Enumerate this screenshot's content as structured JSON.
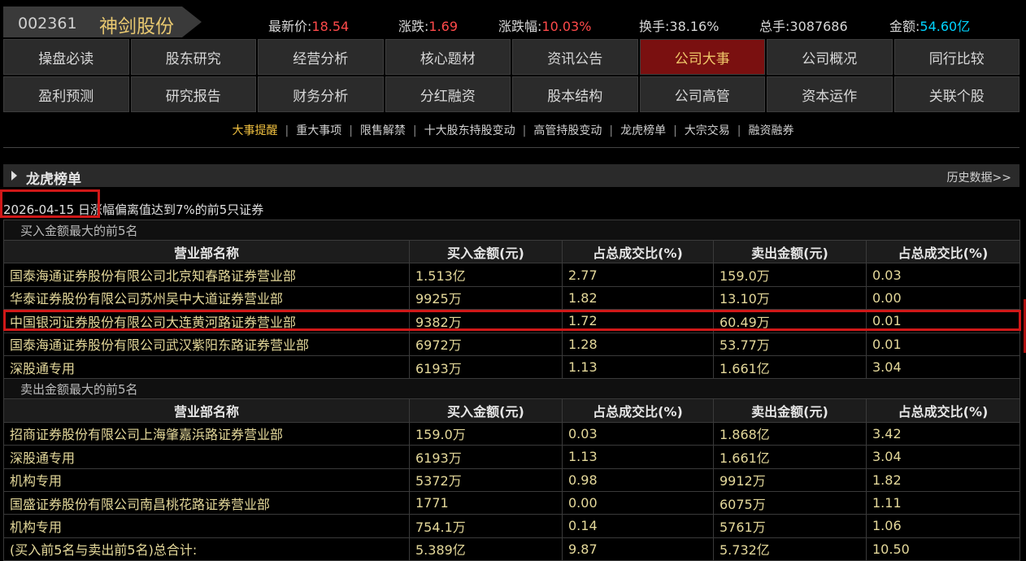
{
  "quote": {
    "code": "002361",
    "name": "神剑股份",
    "price_label": "最新价:",
    "price": "18.54",
    "change_label": "涨跌:",
    "change": "1.69",
    "pct_label": "涨跌幅:",
    "pct": "10.03%",
    "turnover_label": "换手:",
    "turnover": "38.16%",
    "volume_label": "总手:",
    "volume": "3087686",
    "amount_label": "金额:",
    "amount": "54.60亿"
  },
  "nav": [
    "操盘必读",
    "股东研究",
    "经营分析",
    "核心题材",
    "资讯公告",
    "公司大事",
    "公司概况",
    "同行比较",
    "盈利预测",
    "研究报告",
    "财务分析",
    "分红融资",
    "股本结构",
    "公司高管",
    "资本运作",
    "关联个股"
  ],
  "subnav": [
    "大事提醒",
    "重大事项",
    "限售解禁",
    "十大股东持股变动",
    "高管持股变动",
    "龙虎榜单",
    "大宗交易",
    "融资融券"
  ],
  "section": {
    "title": "龙虎榜单",
    "history": "历史数据>>",
    "date": "2026-04-15",
    "date_desc": "日涨幅偏离值达到7%的前5只证券"
  },
  "table": {
    "buy_group": "买入金额最大的前5名",
    "sell_group": "卖出金额最大的前5名",
    "headers": [
      "营业部名称",
      "买入金额(元)",
      "占总成交比(%)",
      "卖出金额(元)",
      "占总成交比(%)"
    ],
    "buy_rows": [
      [
        "国泰海通证券股份有限公司北京知春路证券营业部",
        "1.513亿",
        "2.77",
        "159.0万",
        "0.03"
      ],
      [
        "华泰证券股份有限公司苏州吴中大道证券营业部",
        "9925万",
        "1.82",
        "13.10万",
        "0.00"
      ],
      [
        "中国银河证券股份有限公司大连黄河路证券营业部",
        "9382万",
        "1.72",
        "60.49万",
        "0.01"
      ],
      [
        "国泰海通证券股份有限公司武汉紫阳东路证券营业部",
        "6972万",
        "1.28",
        "53.77万",
        "0.01"
      ],
      [
        "深股通专用",
        "6193万",
        "1.13",
        "1.661亿",
        "3.04"
      ]
    ],
    "sell_rows": [
      [
        "招商证券股份有限公司上海肇嘉浜路证券营业部",
        "159.0万",
        "0.03",
        "1.868亿",
        "3.42"
      ],
      [
        "深股通专用",
        "6193万",
        "1.13",
        "1.661亿",
        "3.04"
      ],
      [
        "机构专用",
        "5372万",
        "0.98",
        "9912万",
        "1.82"
      ],
      [
        "国盛证券股份有限公司南昌桃花路证券营业部",
        "1771",
        "0.00",
        "6075万",
        "1.11"
      ],
      [
        "机构专用",
        "754.1万",
        "0.14",
        "5761万",
        "1.06"
      ],
      [
        "(买入前5名与卖出前5名)总合计:",
        "5.389亿",
        "9.87",
        "5.732亿",
        "10.50"
      ]
    ]
  }
}
